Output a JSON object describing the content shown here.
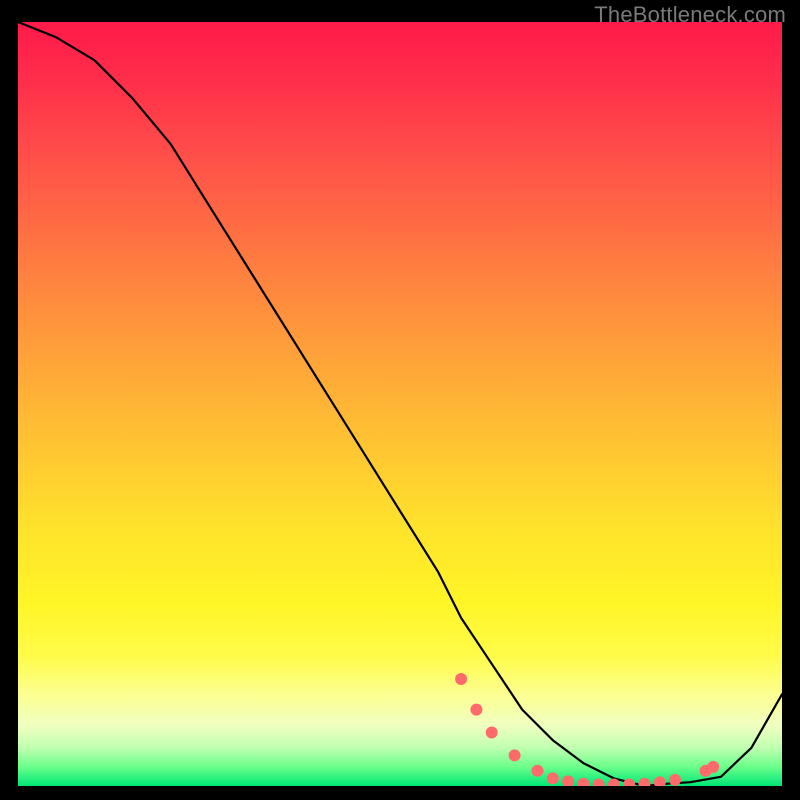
{
  "watermark": "TheBottleneck.com",
  "chart_data": {
    "type": "line",
    "title": "",
    "xlabel": "",
    "ylabel": "",
    "xlim": [
      0,
      100
    ],
    "ylim": [
      0,
      100
    ],
    "grid": false,
    "series": [
      {
        "name": "curve",
        "x": [
          0,
          5,
          10,
          15,
          20,
          25,
          30,
          35,
          40,
          45,
          50,
          55,
          58,
          62,
          66,
          70,
          74,
          78,
          82,
          85,
          88,
          92,
          96,
          100
        ],
        "y": [
          100,
          98,
          95,
          90,
          84,
          76,
          68,
          60,
          52,
          44,
          36,
          28,
          22,
          16,
          10,
          6,
          3,
          1,
          0,
          0.3,
          0.5,
          1.2,
          5,
          12
        ],
        "color": "#000000"
      }
    ],
    "markers": [
      {
        "x": 58,
        "y": 14,
        "color": "#ff6a6a"
      },
      {
        "x": 60,
        "y": 10,
        "color": "#ff6a6a"
      },
      {
        "x": 62,
        "y": 7,
        "color": "#ff6a6a"
      },
      {
        "x": 65,
        "y": 4,
        "color": "#ff6a6a"
      },
      {
        "x": 68,
        "y": 2,
        "color": "#ff6a6a"
      },
      {
        "x": 70,
        "y": 1,
        "color": "#ff6a6a"
      },
      {
        "x": 72,
        "y": 0.6,
        "color": "#ff6a6a"
      },
      {
        "x": 74,
        "y": 0.3,
        "color": "#ff6a6a"
      },
      {
        "x": 76,
        "y": 0.2,
        "color": "#ff6a6a"
      },
      {
        "x": 78,
        "y": 0.2,
        "color": "#ff6a6a"
      },
      {
        "x": 80,
        "y": 0.2,
        "color": "#ff6a6a"
      },
      {
        "x": 82,
        "y": 0.3,
        "color": "#ff6a6a"
      },
      {
        "x": 84,
        "y": 0.5,
        "color": "#ff6a6a"
      },
      {
        "x": 86,
        "y": 0.8,
        "color": "#ff6a6a"
      },
      {
        "x": 90,
        "y": 2,
        "color": "#ff6a6a"
      },
      {
        "x": 91,
        "y": 2.5,
        "color": "#ff6a6a"
      }
    ]
  }
}
